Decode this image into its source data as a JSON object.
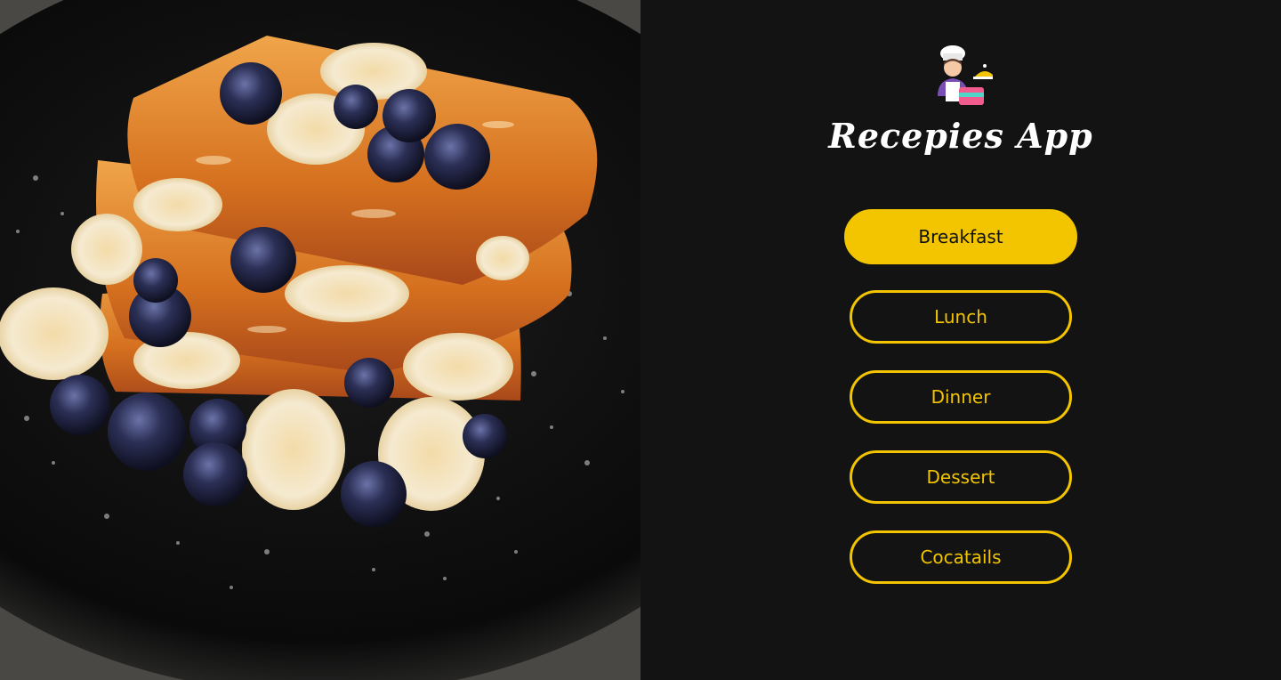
{
  "hero": {
    "icon": "food-photo"
  },
  "app": {
    "title": "Recepies App",
    "logo_icon": "chef-icon"
  },
  "menu": {
    "items": [
      {
        "label": "Breakfast",
        "active": true
      },
      {
        "label": "Lunch",
        "active": false
      },
      {
        "label": "Dinner",
        "active": false
      },
      {
        "label": "Dessert",
        "active": false
      },
      {
        "label": "Cocatails",
        "active": false
      }
    ]
  },
  "colors": {
    "accent": "#f2c500",
    "background": "#131313",
    "text": "#ffffff"
  }
}
